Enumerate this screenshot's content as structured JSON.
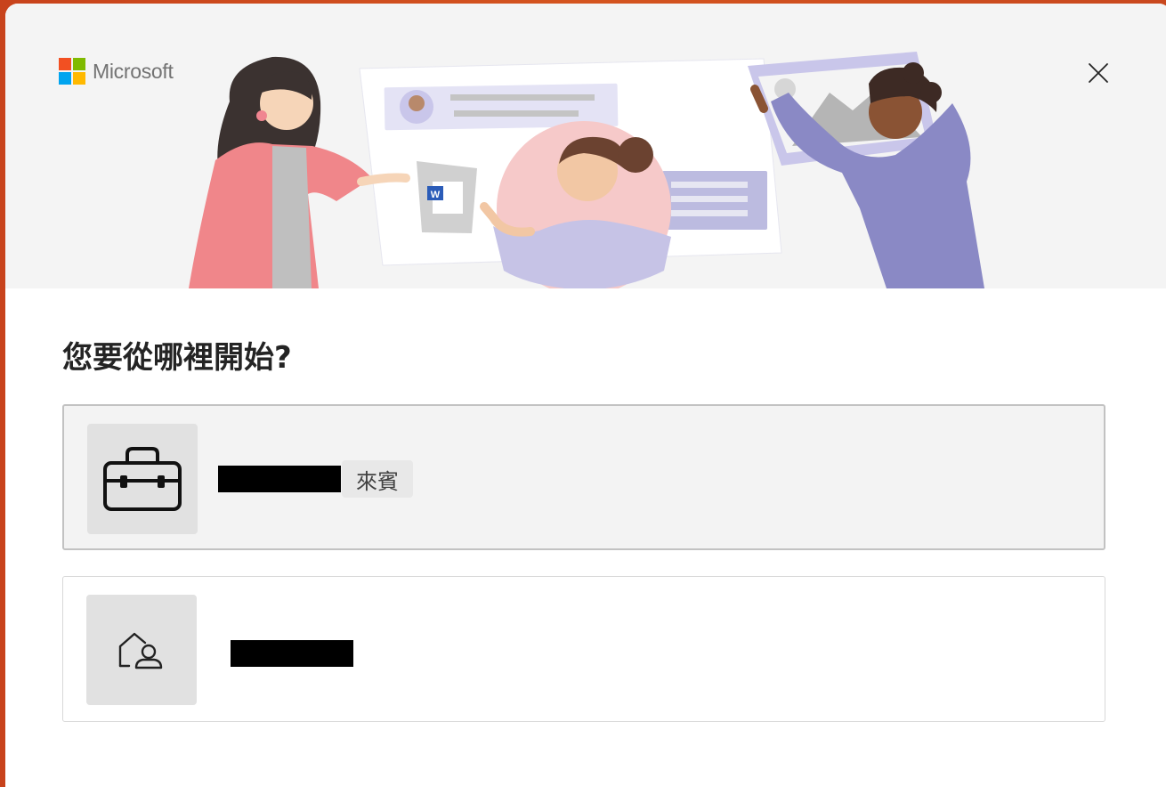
{
  "app": {
    "brand": "Microsoft",
    "logo_colors": [
      "#f25022",
      "#7fba00",
      "#00a4ef",
      "#ffb900"
    ]
  },
  "dialog": {
    "title": "您要從哪裡開始?",
    "close_icon": "close-icon"
  },
  "options": [
    {
      "icon": "briefcase-icon",
      "account_name": "",
      "account_name_redacted": true,
      "badge": "來賓",
      "selected": true
    },
    {
      "icon": "home-person-icon",
      "account_name": "",
      "account_name_redacted": true,
      "selected": false
    }
  ]
}
